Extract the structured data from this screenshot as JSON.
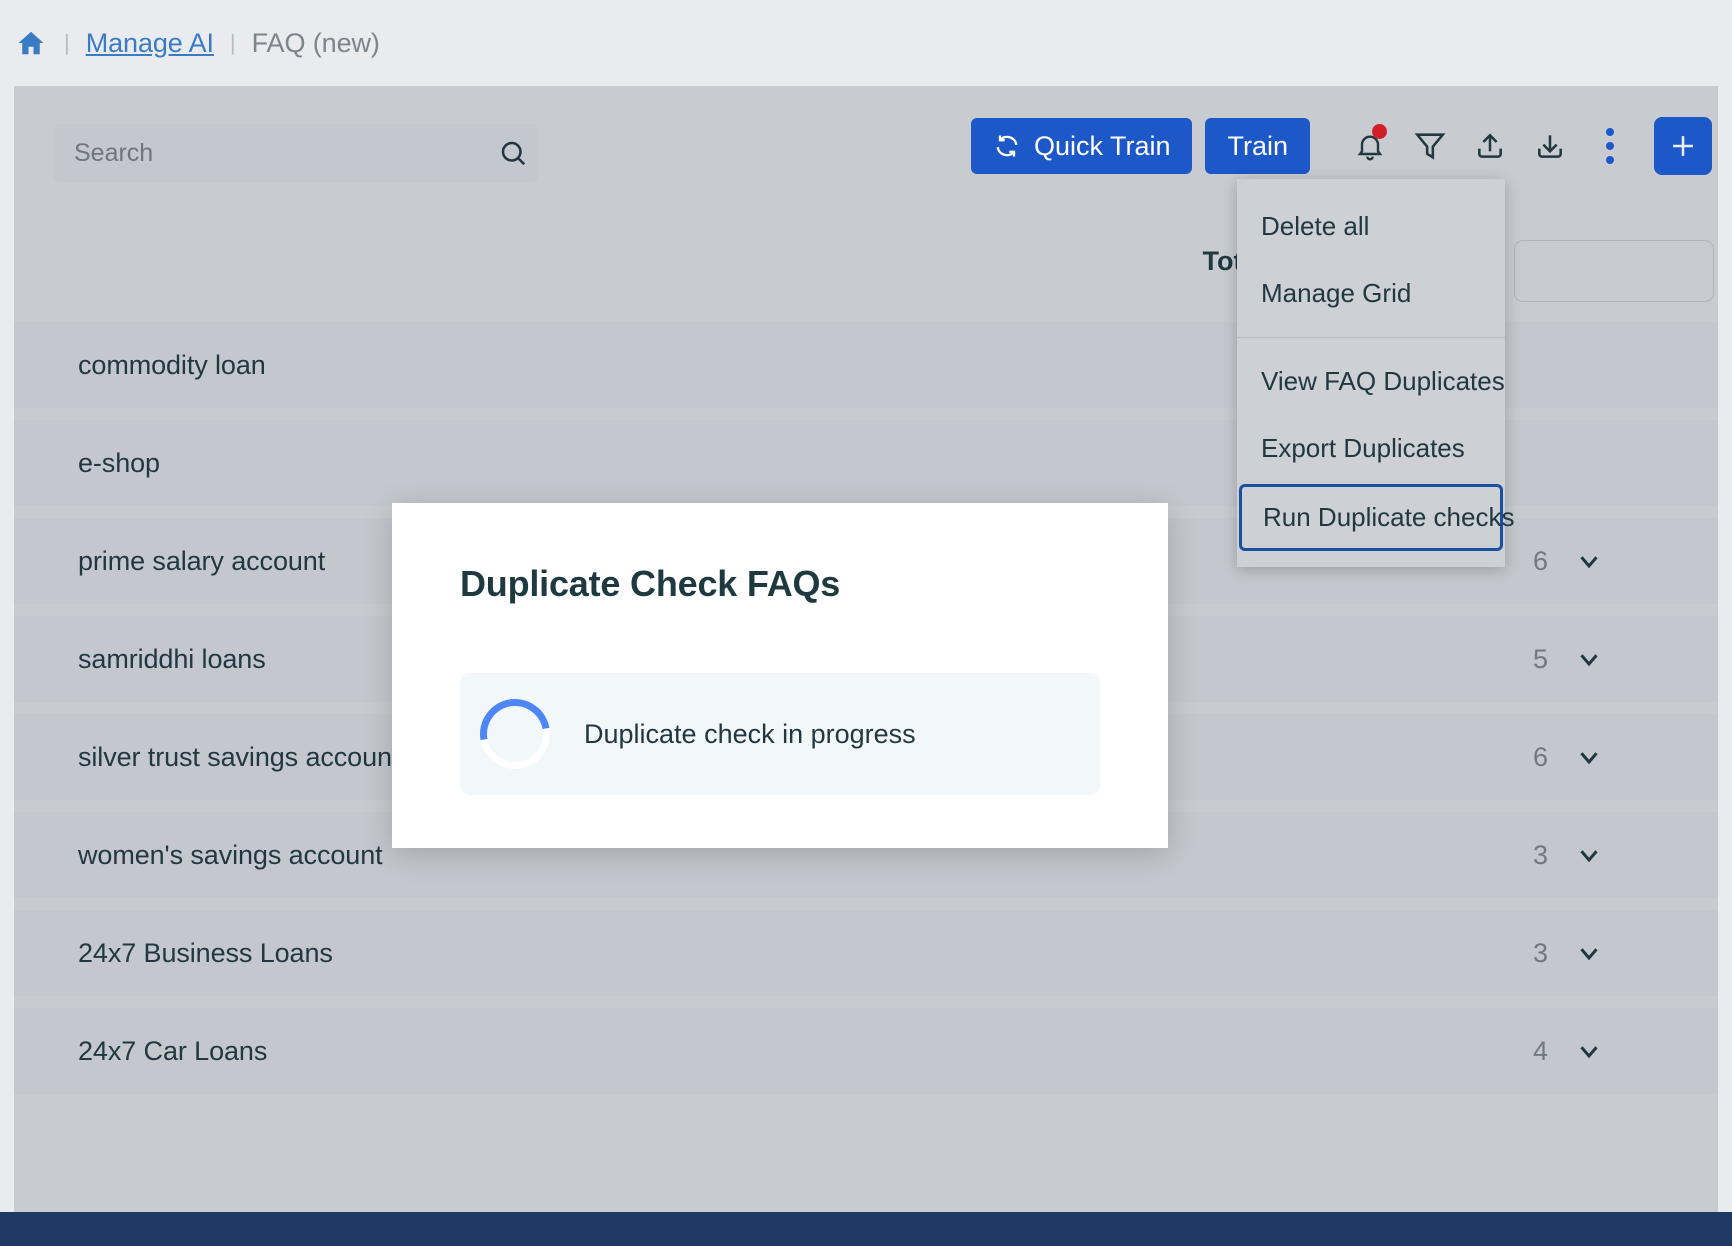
{
  "breadcrumb": {
    "home_icon": "home-icon",
    "separator": "|",
    "link": "Manage AI",
    "current": "FAQ (new)"
  },
  "toolbar": {
    "search": {
      "placeholder": "Search",
      "value": ""
    },
    "quick_train_label": "Quick Train",
    "train_label": "Train",
    "icons": {
      "notification": "bell-icon",
      "filter": "funnel-icon",
      "upload": "upload-icon",
      "download": "download-icon",
      "more": "vertical-ellipsis-icon",
      "add": "plus-icon"
    },
    "accent_color": "#1d58c9",
    "badge_color": "#cf2029"
  },
  "summary": {
    "total_label": "Total FAQ(s"
  },
  "menu": {
    "groups": [
      {
        "items": [
          {
            "label": "Delete all",
            "focused": false
          },
          {
            "label": "Manage Grid",
            "focused": false
          }
        ]
      },
      {
        "items": [
          {
            "label": "View FAQ Duplicates",
            "focused": false
          },
          {
            "label": "Export Duplicates",
            "focused": false
          },
          {
            "label": "Run Duplicate checks",
            "focused": true
          }
        ]
      }
    ]
  },
  "faq_rows": [
    {
      "title": "commodity loan",
      "count": ""
    },
    {
      "title": "e-shop",
      "count": ""
    },
    {
      "title": "prime salary account",
      "count": "6"
    },
    {
      "title": "samriddhi loans",
      "count": "5"
    },
    {
      "title": "silver trust savings account",
      "count": "6"
    },
    {
      "title": "women's savings account",
      "count": "3"
    },
    {
      "title": "24x7 Business Loans",
      "count": "3"
    },
    {
      "title": "24x7 Car Loans",
      "count": "4"
    }
  ],
  "modal": {
    "title": "Duplicate Check FAQs",
    "progress_text": "Duplicate check in progress",
    "spinner_color": "#4f86f7"
  }
}
